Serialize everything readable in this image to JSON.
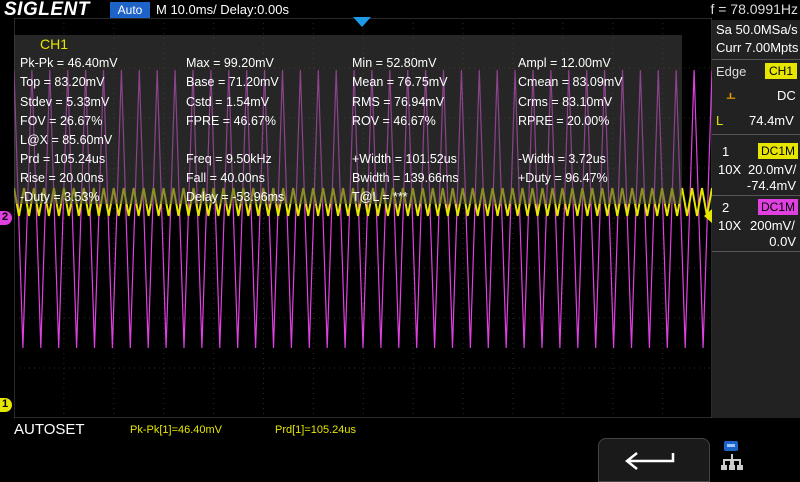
{
  "brand": "SIGLENT",
  "trigger_mode": "Auto",
  "timebase": "M 10.0ms/ Delay:0.00s",
  "frequency_readout": "f = 78.0991Hz",
  "sample_rate": "Sa 50.0MSa/s",
  "memory_depth": "Curr 7.00Mpts",
  "trigger": {
    "type": "Edge",
    "source": "CH1",
    "coupling": "DC",
    "level_label": "L",
    "level": "74.4mV"
  },
  "channels": [
    {
      "number": "1",
      "coupling": "DC1M",
      "probe": "10X",
      "scale": "20.0mV/",
      "offset": "-74.4mV",
      "color": "#e6e600"
    },
    {
      "number": "2",
      "coupling": "DC1M",
      "probe": "10X",
      "scale": "200mV/",
      "offset": "0.0V",
      "color": "#e040e0"
    }
  ],
  "measurement_panel": {
    "title": "CH1",
    "rows": [
      [
        "Pk-Pk = 46.40mV",
        "Max = 99.20mV",
        "Min = 52.80mV",
        "Ampl = 12.00mV"
      ],
      [
        "Top = 83.20mV",
        "Base = 71.20mV",
        "Mean = 76.75mV",
        "Cmean = 83.09mV"
      ],
      [
        "Stdev = 5.33mV",
        "Cstd = 1.54mV",
        "RMS = 76.94mV",
        "Crms = 83.10mV"
      ],
      [
        "FOV = 26.67%",
        "FPRE = 46.67%",
        "ROV = 46.67%",
        "RPRE = 20.00%"
      ],
      [
        "L@X = 85.60mV",
        "",
        "",
        ""
      ],
      [
        "Prd = 105.24us",
        "Freq = 9.50kHz",
        "+Width = 101.52us",
        "-Width = 3.72us"
      ],
      [
        "Rise = 20.00ns",
        "Fall = 40.00ns",
        "Bwidth = 139.66ms",
        "+Duty = 96.47%"
      ],
      [
        "-Duty = 3.53%",
        "Delay = -53.96ms",
        "T@L = ***",
        ""
      ]
    ]
  },
  "bottom": {
    "autoset_label": "AUTOSET",
    "measure_1": "Pk-Pk[1]=46.40mV",
    "measure_2": "Prd[1]=105.24us"
  },
  "markers": {
    "ch1_marker": "1",
    "ch2_marker": "2"
  },
  "icons": {
    "back": "back-arrow-icon",
    "network": "network-icon",
    "trigger_edge": "rising-edge-icon"
  },
  "colors": {
    "ch1": "#e6e600",
    "ch2": "#e040e0",
    "accent_blue": "#1e63c8"
  }
}
